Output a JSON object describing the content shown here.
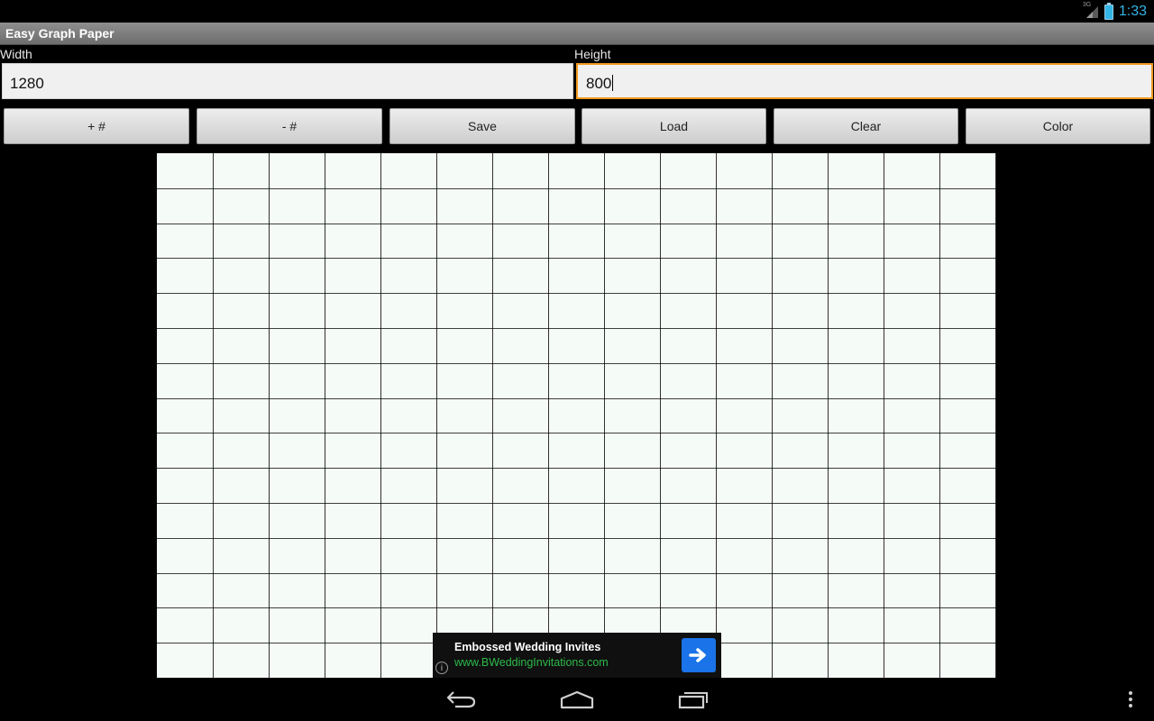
{
  "status_bar": {
    "network_label": "3G",
    "time": "1:33",
    "icons": [
      "signal-icon",
      "battery-icon"
    ]
  },
  "app": {
    "title": "Easy Graph Paper"
  },
  "fields": {
    "width_label": "Width",
    "width_value": "1280",
    "height_label": "Height",
    "height_value": "800"
  },
  "buttons": {
    "plus_grid": "+ #",
    "minus_grid": "- #",
    "save": "Save",
    "load": "Load",
    "clear": "Clear",
    "color": "Color"
  },
  "graph": {
    "columns": 15,
    "rows": 15,
    "background": "#f5fbf6",
    "line_color": "#000000"
  },
  "ad": {
    "title": "Embossed Wedding Invites",
    "url": "www.BWeddingInvitations.com",
    "info_glyph": "i",
    "arrow_color": "#1a73e8",
    "url_color": "#2dbb4a"
  },
  "nav_bar": {
    "icons": [
      "back-icon",
      "home-icon",
      "recent-apps-icon",
      "overflow-menu-icon"
    ]
  },
  "colors": {
    "accent": "#33b5e5",
    "focus": "#f29a1f"
  }
}
